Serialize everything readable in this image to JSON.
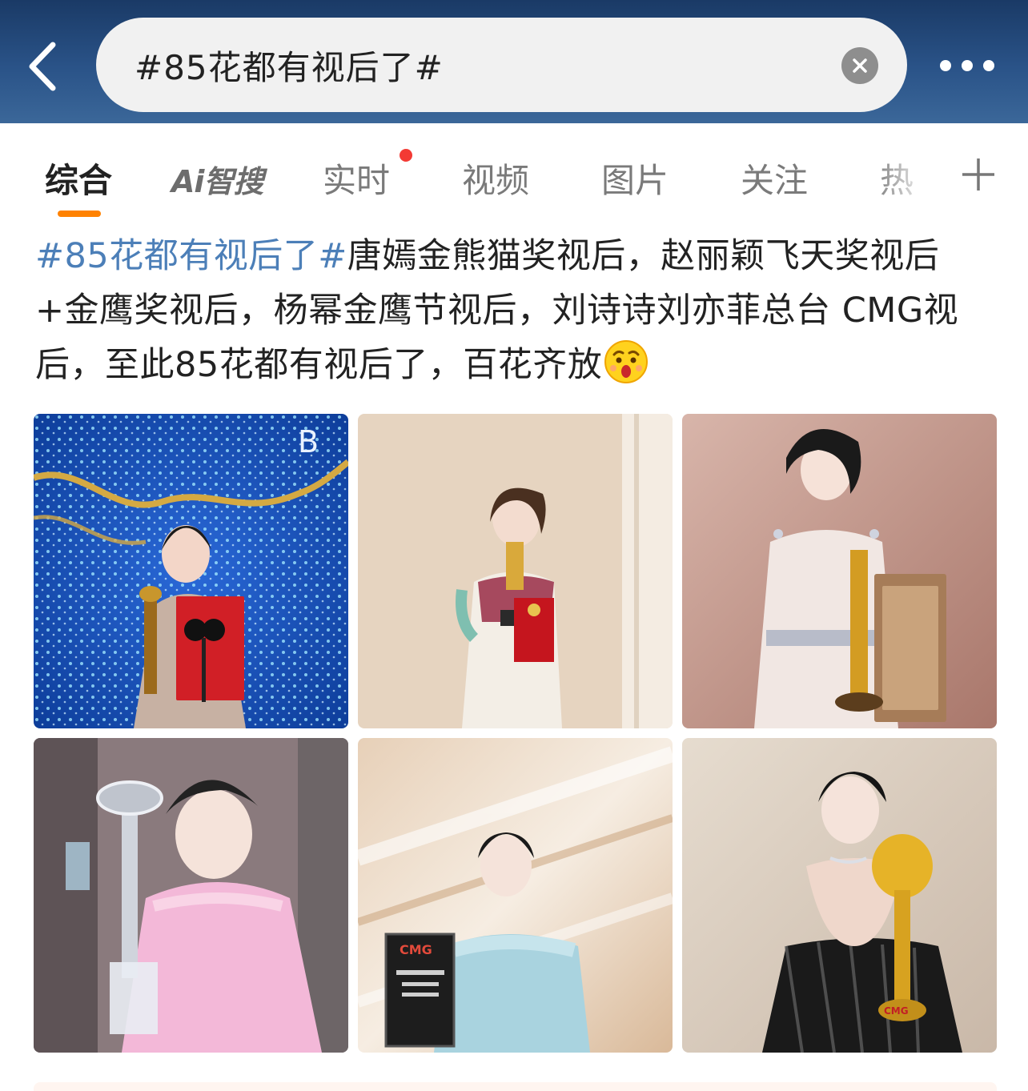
{
  "header": {
    "back_icon": "chevron-left-icon",
    "search_value": "#85花都有视后了#",
    "clear_icon": "close-icon",
    "more_icon": "more-dots-icon"
  },
  "tabs": [
    {
      "label": "综合",
      "active": true
    },
    {
      "label": "Ai智搜",
      "active": false
    },
    {
      "label": "实时",
      "active": false,
      "badge": "red-dot"
    },
    {
      "label": "视频",
      "active": false
    },
    {
      "label": "图片",
      "active": false
    },
    {
      "label": "关注",
      "active": false
    },
    {
      "label": "热",
      "active": false
    }
  ],
  "tab_accent_color": "#ff8200",
  "post": {
    "hashtag": "#85花都有视后了#",
    "text": "唐嫣金熊猫奖视后，赵丽颖飞天奖视后+金鹰奖视后，杨幂金鹰节视后，刘诗诗刘亦菲总台 CMG视后，至此85花都有视后了，百花齐放",
    "emoji": "surprised-face-emoji",
    "hashtag_color": "#4c7fb8"
  },
  "images": [
    {
      "name": "photo-tang-yan",
      "overlay_text": "B"
    },
    {
      "name": "photo-zhao-liying"
    },
    {
      "name": "photo-zhao-liying-2"
    },
    {
      "name": "photo-yang-mi"
    },
    {
      "name": "photo-liu-shishi",
      "overlay_text": "CMG"
    },
    {
      "name": "photo-liu-yifei",
      "overlay_text": "CMG"
    }
  ]
}
